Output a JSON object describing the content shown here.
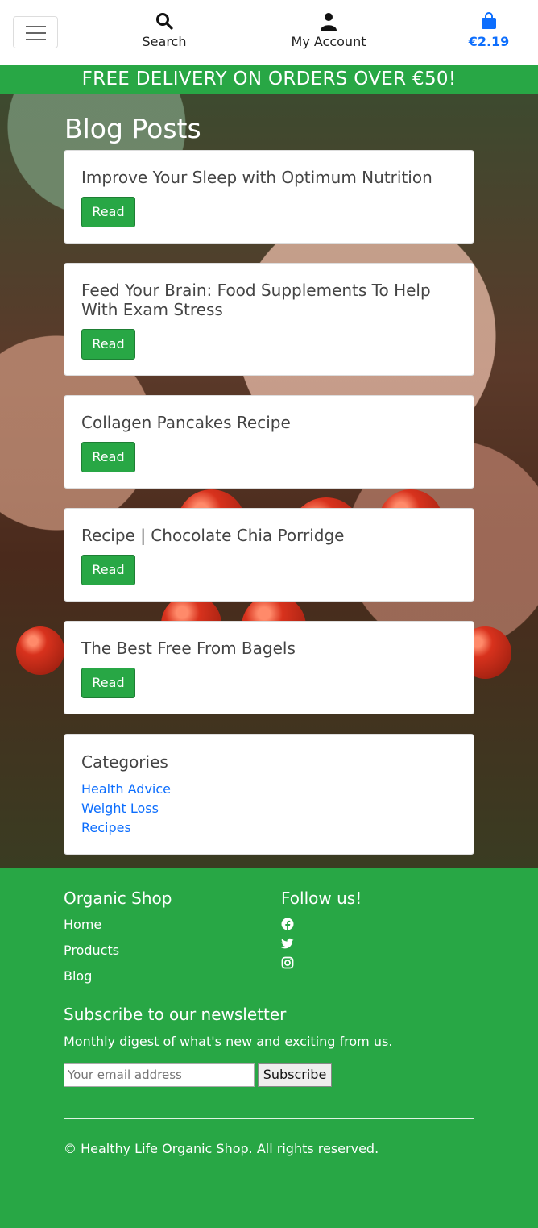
{
  "header": {
    "search_label": "Search",
    "account_label": "My Account",
    "bag_total": "€2.19"
  },
  "promo": "FREE DELIVERY ON ORDERS OVER €50!",
  "main": {
    "title": "Blog Posts",
    "read_label": "Read",
    "posts": [
      {
        "title": "Improve Your Sleep with Optimum Nutrition"
      },
      {
        "title": "Feed Your Brain: Food Supplements To Help With Exam Stress"
      },
      {
        "title": "Collagen Pancakes Recipe"
      },
      {
        "title": "Recipe | Chocolate Chia Porridge"
      },
      {
        "title": "The Best Free From Bagels"
      }
    ],
    "categories": {
      "title": "Categories",
      "items": [
        "Health Advice",
        "Weight Loss",
        "Recipes"
      ]
    }
  },
  "footer": {
    "brand": "Organic Shop",
    "links": [
      "Home",
      "Products",
      "Blog"
    ],
    "follow_title": "Follow us!",
    "social_icons": [
      "facebook-icon",
      "twitter-icon",
      "instagram-icon"
    ],
    "newsletter_title": "Subscribe to our newsletter",
    "newsletter_text": "Monthly digest of what's new and exciting from us.",
    "email_placeholder": "Your email address",
    "subscribe_label": "Subscribe",
    "copyright": "© Healthy Life Organic Shop. All rights reserved."
  },
  "colors": {
    "brand_green": "#28a745",
    "link_blue": "#0d6efd"
  }
}
